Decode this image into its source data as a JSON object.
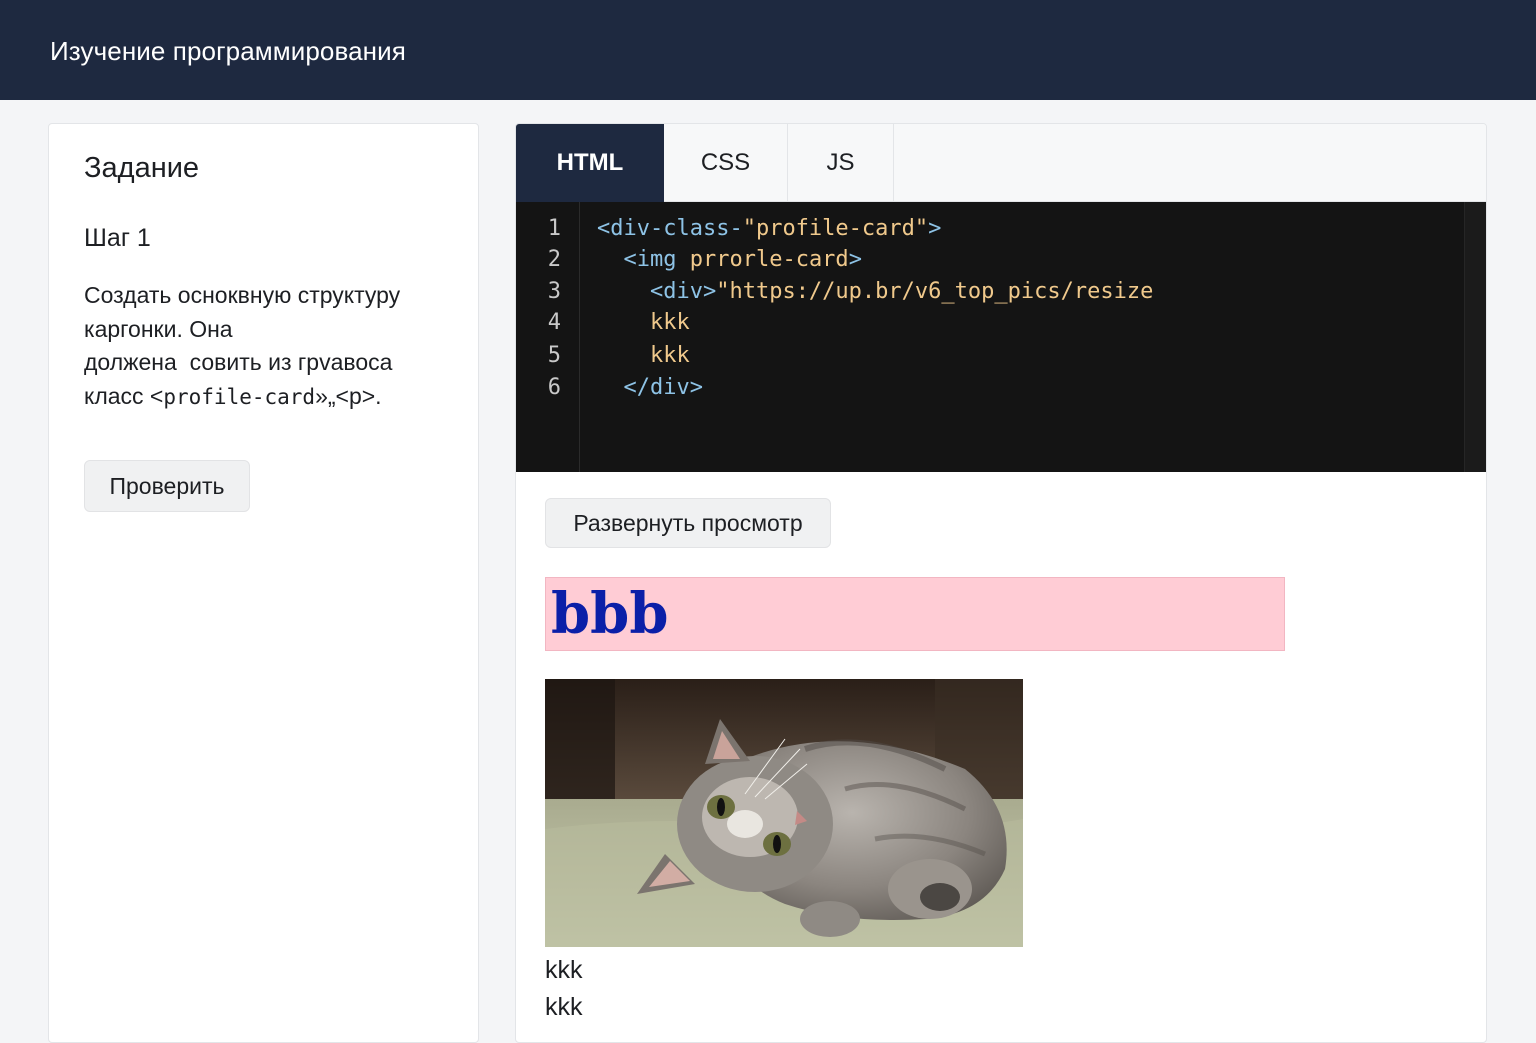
{
  "header": {
    "title": "Изучение программирования"
  },
  "task": {
    "heading": "Задание",
    "step": "Шаг 1",
    "lines": [
      {
        "pre": "Создать осноквную структуру",
        "code": "",
        "post": ""
      },
      {
        "pre": "каргонки. Она",
        "code": "",
        "post": ""
      },
      {
        "pre": "должена  совить из грvавоса",
        "code": "",
        "post": ""
      },
      {
        "pre": "класс <",
        "code": "profile-card",
        "post": "»„<p>."
      }
    ],
    "check_button": "Проверить"
  },
  "editor": {
    "tabs": [
      {
        "label": "HTML",
        "active": true
      },
      {
        "label": "CSS",
        "active": false
      },
      {
        "label": "JS",
        "active": false
      }
    ],
    "line_numbers": [
      "1",
      "2",
      "3",
      "4",
      "5",
      "6"
    ],
    "code": [
      {
        "indent": "",
        "tag": "<div-class-",
        "str": "\"profile-card\"",
        "tag2": ">"
      },
      {
        "indent": "  ",
        "tag": "<img ",
        "str": "prrorle-card",
        "tag2": ">"
      },
      {
        "indent": "    ",
        "tag": "<div>",
        "str": "\"https://up.br/v6_top_pics/resize",
        "tag2": ""
      },
      {
        "indent": "    ",
        "tag": "",
        "str": "kkk",
        "tag2": ""
      },
      {
        "indent": "    ",
        "tag": "",
        "str": "kkk",
        "tag2": ""
      },
      {
        "indent": "  ",
        "tag": "</div>",
        "str": "",
        "tag2": ""
      }
    ]
  },
  "preview": {
    "expand_button": "Развернуть просмотр",
    "heading": "bbb",
    "texts": [
      "kkk",
      "kkk"
    ]
  },
  "colors": {
    "header_bg": "#1e2940",
    "code_bg": "#141414",
    "preview_heading_bg": "#ffccd5",
    "preview_heading_color": "#0b1fa8"
  }
}
